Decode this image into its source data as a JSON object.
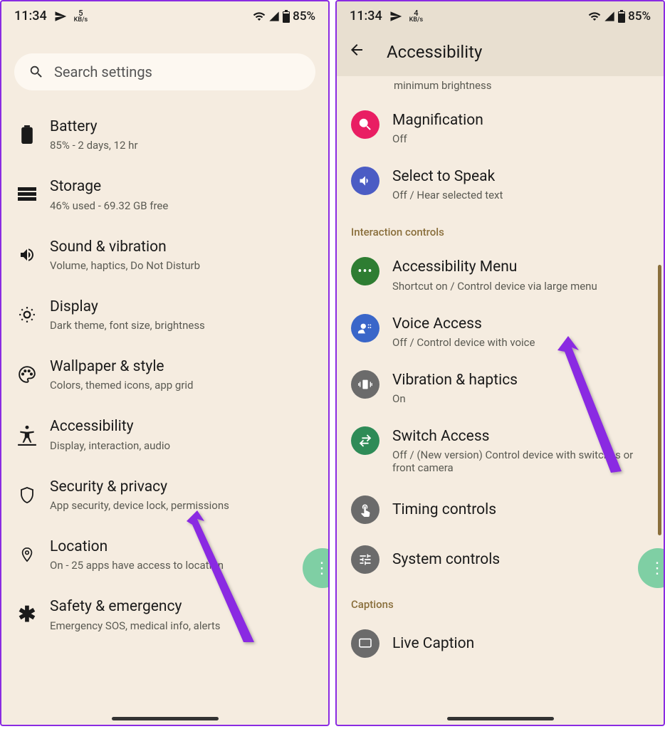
{
  "statusbar": {
    "time": "11:34",
    "kb_num_left": "5",
    "kb_num_right": "4",
    "kb_label": "KB/s",
    "battery": "85%"
  },
  "left": {
    "search_placeholder": "Search settings",
    "items": [
      {
        "title": "Battery",
        "subtitle": "85% - 2 days, 12 hr"
      },
      {
        "title": "Storage",
        "subtitle": "46% used - 69.32 GB free"
      },
      {
        "title": "Sound & vibration",
        "subtitle": "Volume, haptics, Do Not Disturb"
      },
      {
        "title": "Display",
        "subtitle": "Dark theme, font size, brightness"
      },
      {
        "title": "Wallpaper & style",
        "subtitle": "Colors, themed icons, app grid"
      },
      {
        "title": "Accessibility",
        "subtitle": "Display, interaction, audio"
      },
      {
        "title": "Security & privacy",
        "subtitle": "App security, device lock, permissions"
      },
      {
        "title": "Location",
        "subtitle": "On - 25 apps have access to location"
      },
      {
        "title": "Safety & emergency",
        "subtitle": "Emergency SOS, medical info, alerts"
      }
    ]
  },
  "right": {
    "header": "Accessibility",
    "brightness_tail": "minimum brightness",
    "sections": {
      "interaction": "Interaction controls",
      "captions": "Captions"
    },
    "items": {
      "magnification": {
        "title": "Magnification",
        "subtitle": "Off"
      },
      "select_speak": {
        "title": "Select to Speak",
        "subtitle": "Off / Hear selected text"
      },
      "a11y_menu": {
        "title": "Accessibility Menu",
        "subtitle": "Shortcut on / Control device via large menu"
      },
      "voice_access": {
        "title": "Voice Access",
        "subtitle": "Off / Control device with voice"
      },
      "vibration": {
        "title": "Vibration & haptics",
        "subtitle": "On"
      },
      "switch_access": {
        "title": "Switch Access",
        "subtitle": "Off / (New version) Control device with switches or front camera"
      },
      "timing": {
        "title": "Timing controls"
      },
      "system": {
        "title": "System controls"
      },
      "live_caption": {
        "title": "Live Caption"
      }
    }
  }
}
